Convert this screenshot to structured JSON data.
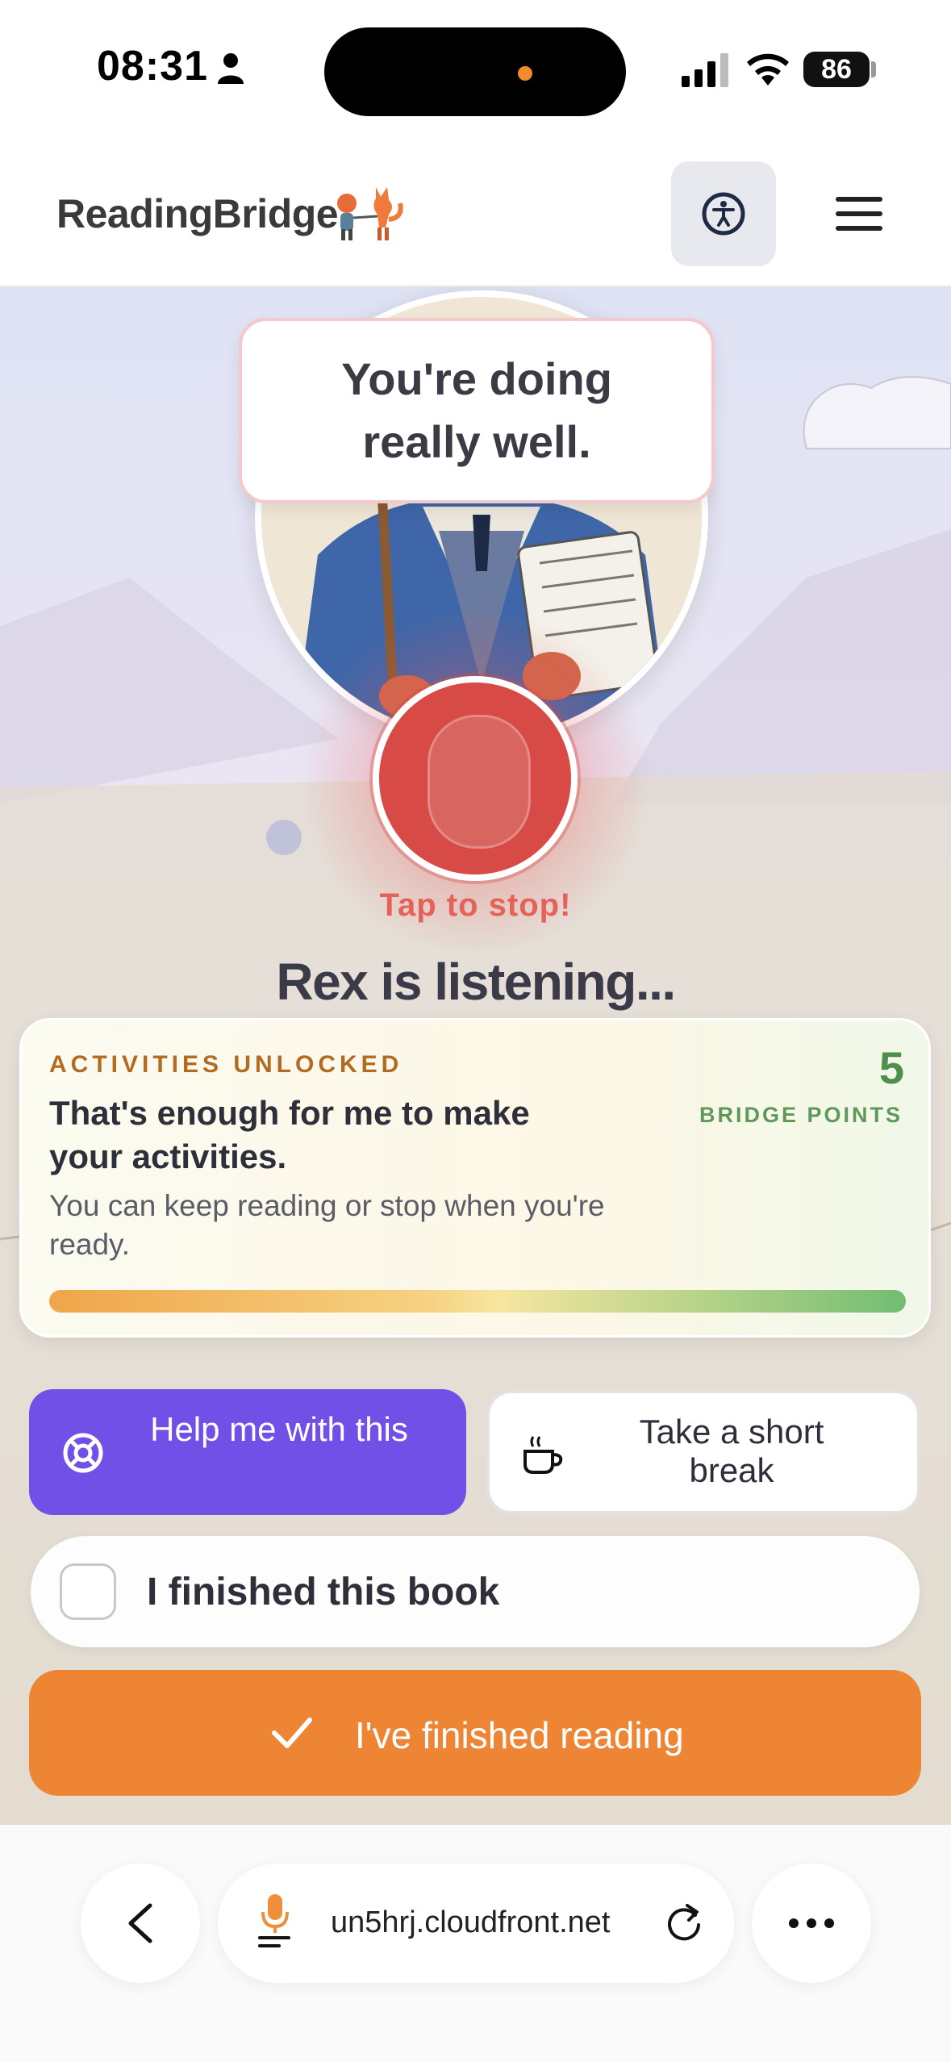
{
  "status_bar": {
    "time": "08:31",
    "battery": "86"
  },
  "header": {
    "logo": "ReadingBridge"
  },
  "speech_bubble": "You're doing really well.",
  "mic": {
    "hint": "Tap to stop!",
    "status": "Rex is listening..."
  },
  "activities_card": {
    "kicker": "ACTIVITIES UNLOCKED",
    "title": "That's enough for me to make your activities.",
    "subtitle": "You can keep reading or stop when you're ready.",
    "points_value": "5",
    "points_label": "BRIDGE POINTS",
    "progress": 1.0
  },
  "actions": {
    "help_label": "Help me with this",
    "break_label": "Take a short break",
    "finished_book_label": "I finished this book",
    "finished_book_checked": false,
    "done_label": "I've finished reading"
  },
  "browser": {
    "url": "un5hrj.cloudfront.net"
  },
  "colors": {
    "primary_purple": "#7050e6",
    "accent_orange": "#ed8534",
    "mic_red": "#d84a46",
    "points_green": "#4f8f4c"
  },
  "icons": [
    "person-icon",
    "signal-icon",
    "wifi-icon",
    "accessibility-icon",
    "menu-icon",
    "lifebuoy-icon",
    "coffee-icon",
    "check-icon",
    "back-icon",
    "mic-icon",
    "reload-icon",
    "more-icon"
  ]
}
